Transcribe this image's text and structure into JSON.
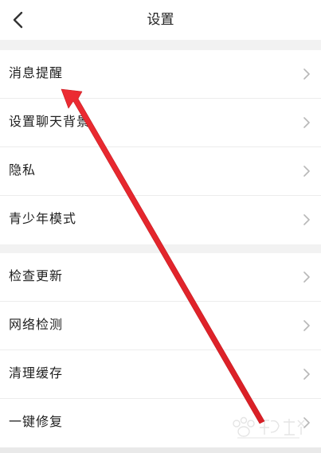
{
  "header": {
    "title": "设置"
  },
  "groups": [
    {
      "items": [
        {
          "label": "消息提醒"
        },
        {
          "label": "设置聊天背景"
        },
        {
          "label": "隐私"
        },
        {
          "label": "青少年模式"
        }
      ]
    },
    {
      "items": [
        {
          "label": "检查更新"
        },
        {
          "label": "网络检测"
        },
        {
          "label": "清理缓存"
        },
        {
          "label": "一键修复"
        }
      ]
    }
  ],
  "icons": {
    "back": "chevron-left-icon",
    "row_arrow": "chevron-right-icon"
  },
  "colors": {
    "annotation_arrow": "#e8262d",
    "chevron": "#b8b8b8",
    "background": "#f2f2f2"
  }
}
